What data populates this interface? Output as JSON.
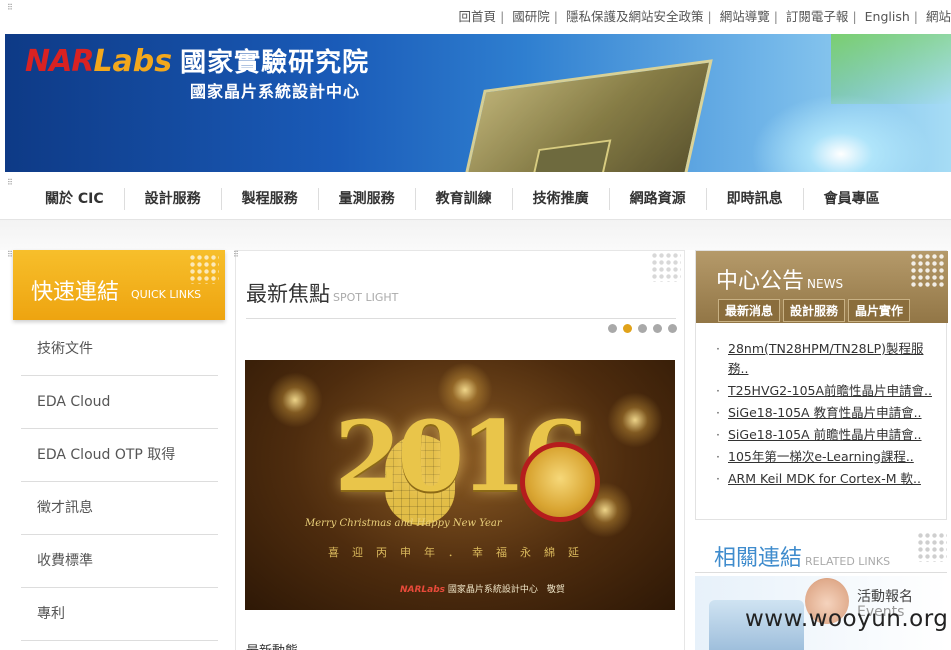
{
  "topbar": {
    "links": [
      "回首頁",
      "國研院",
      "隱私保護及網站安全政策",
      "網站導覽",
      "訂閱電子報",
      "English",
      "網站"
    ]
  },
  "banner": {
    "logo_nar": "NAR",
    "logo_labs": "Labs",
    "org_name": "國家實驗研究院",
    "subtitle": "國家晶片系統設計中心"
  },
  "nav": {
    "items": [
      "關於 CIC",
      "設計服務",
      "製程服務",
      "量測服務",
      "教育訓練",
      "技術推廣",
      "網路資源",
      "即時訊息",
      "會員專區"
    ]
  },
  "quick_links": {
    "title_zh": "快速連結",
    "title_en": "QUICK LINKS",
    "items": [
      "技術文件",
      "EDA Cloud",
      "EDA Cloud OTP 取得",
      "徵才訊息",
      "收費標準",
      "專利"
    ]
  },
  "focus": {
    "title_zh": "最新焦點",
    "title_en": "SPOT LIGHT",
    "pager_count": 5,
    "pager_active": 1,
    "slide": {
      "year": "2016",
      "script": "Merry Christmas and Happy New Year",
      "blessing": "喜迎丙申年．幸福永綿延",
      "brand": "NARLabs",
      "sign": "國家晶片系統設計中心　敬賀"
    },
    "below_text": "最新動態"
  },
  "news": {
    "title_zh": "中心公告",
    "title_en": "NEWS",
    "tabs": [
      "最新消息",
      "設計服務",
      "晶片實作"
    ],
    "items": [
      "28nm(TN28HPM/TN28LP)製程服務..",
      "T25HVG2-105A前瞻性晶片申請會..",
      "SiGe18-105A 教育性晶片申請會..",
      "SiGe18-105A 前瞻性晶片申請會..",
      "105年第一梯次e-Learning課程..",
      "ARM Keil MDK for Cortex-M 軟.."
    ]
  },
  "related": {
    "title_zh": "相關連結",
    "title_en": "RELATED LINKS",
    "event_zh": "活動報名",
    "event_en": "Events"
  },
  "watermark": "www.wooyun.org",
  "colors": {
    "quick_links_gold": "#f0a814",
    "news_brown": "#a38a5a",
    "related_blue": "#3f8ccd",
    "pager_active": "#e0a21a"
  }
}
